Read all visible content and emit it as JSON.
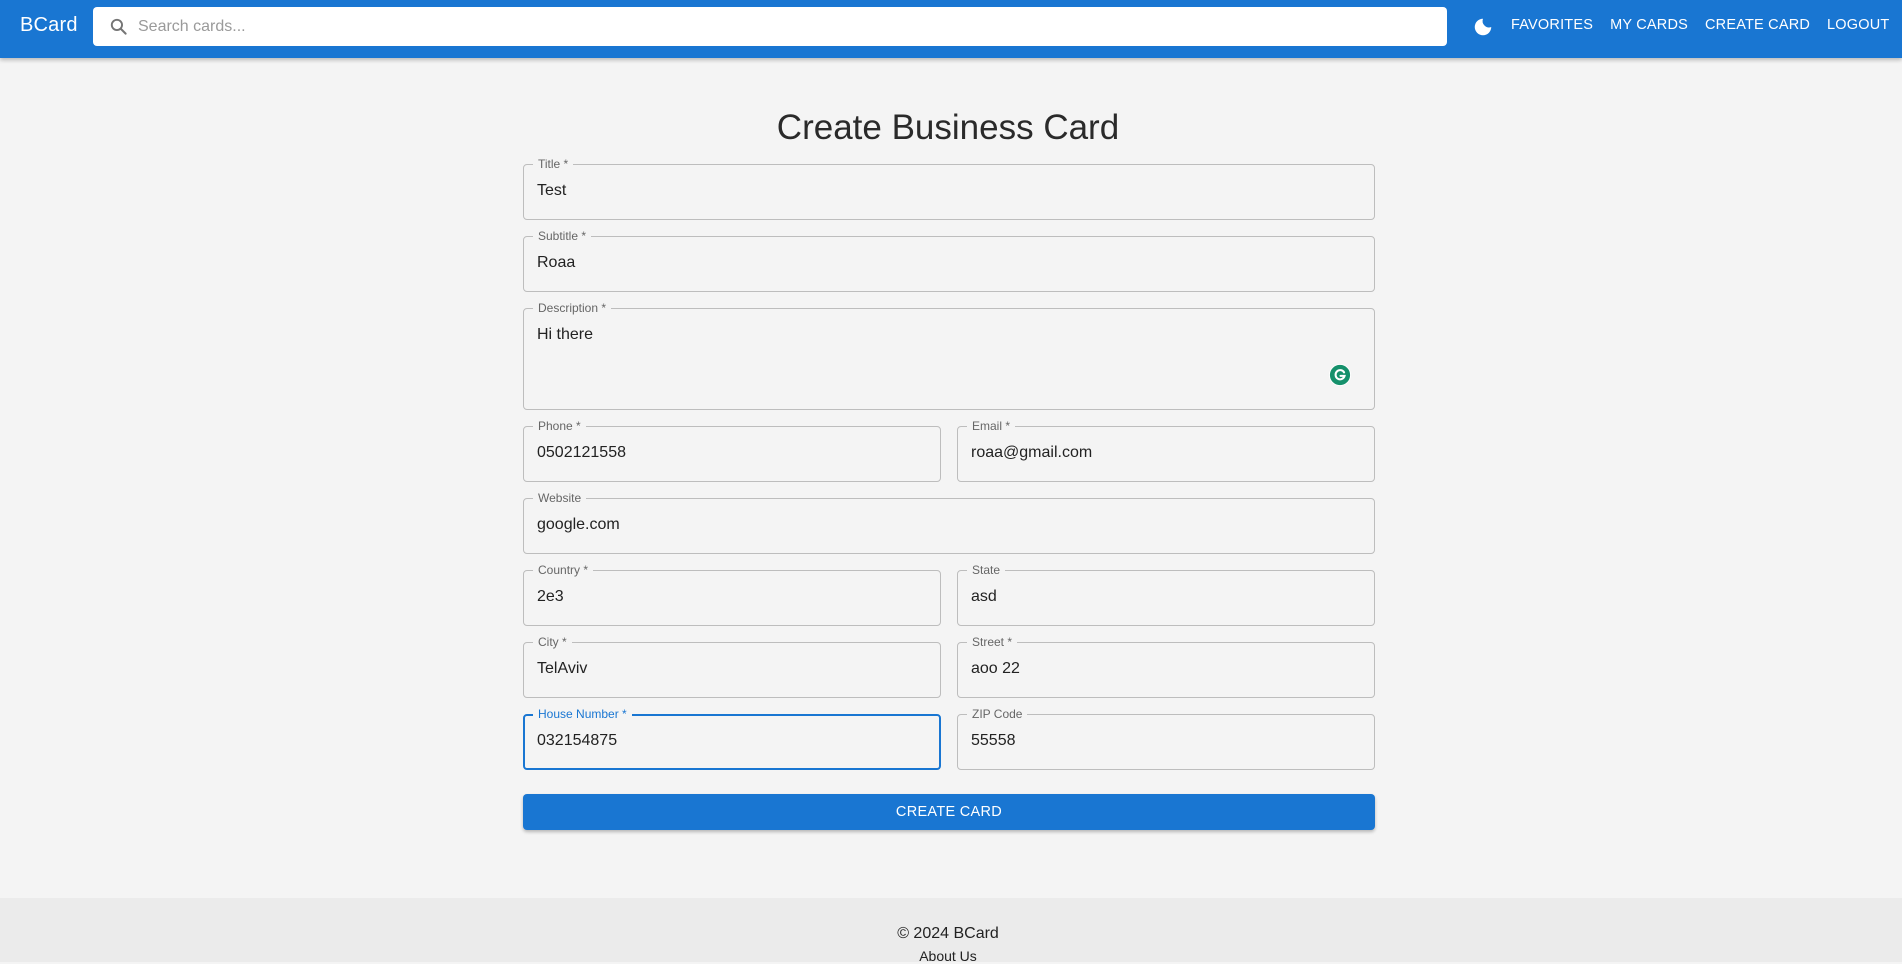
{
  "app": {
    "brand": "BCard"
  },
  "search": {
    "placeholder": "Search cards...",
    "icon": "search-icon"
  },
  "nav": {
    "theme_icon": "moon-icon",
    "items": [
      {
        "label": "FAVORITES"
      },
      {
        "label": "MY CARDS"
      },
      {
        "label": "CREATE CARD"
      },
      {
        "label": "LOGOUT"
      }
    ]
  },
  "form": {
    "title": "Create Business Card",
    "fields": {
      "title": {
        "label": "Title *",
        "value": "Test"
      },
      "subtitle": {
        "label": "Subtitle *",
        "value": "Roaa"
      },
      "description": {
        "label": "Description *",
        "value": "Hi there"
      },
      "phone": {
        "label": "Phone *",
        "value": "0502121558"
      },
      "email": {
        "label": "Email *",
        "value": "roaa@gmail.com"
      },
      "website": {
        "label": "Website",
        "value": "google.com"
      },
      "country": {
        "label": "Country *",
        "value": "2e3"
      },
      "state": {
        "label": "State",
        "value": "asd"
      },
      "city": {
        "label": "City *",
        "value": "TelAviv"
      },
      "street": {
        "label": "Street *",
        "value": "aoo 22"
      },
      "house_number": {
        "label": "House Number *",
        "value": "032154875"
      },
      "zip": {
        "label": "ZIP Code",
        "value": "55558"
      }
    },
    "submit_label": "CREATE CARD",
    "grammarly_icon": "grammarly-icon"
  },
  "footer": {
    "copyright": "© 2024 BCard",
    "about": "About Us"
  },
  "colors": {
    "primary": "#1976d2",
    "background": "#f4f4f4",
    "footer": "#ebebeb",
    "grammarly": "#15906b"
  }
}
